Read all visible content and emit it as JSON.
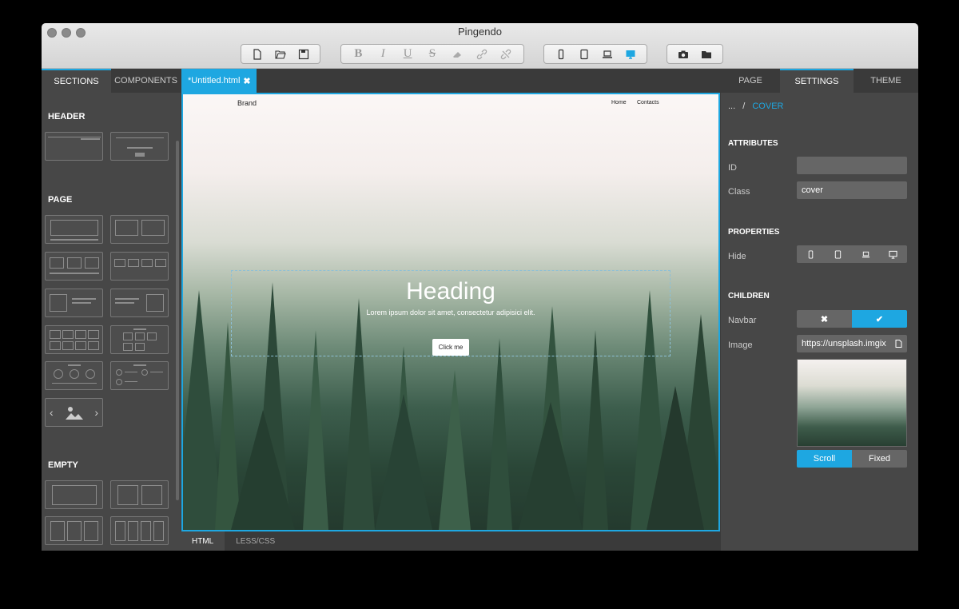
{
  "window": {
    "title": "Pingendo"
  },
  "left": {
    "tabs": [
      "SECTIONS",
      "COMPONENTS"
    ],
    "sections": [
      "HEADER",
      "PAGE",
      "EMPTY"
    ]
  },
  "editor": {
    "file_tab": "*Untitled.html",
    "code_tabs": [
      "HTML",
      "LESS/CSS"
    ]
  },
  "preview": {
    "brand": "Brand",
    "nav_links": [
      "Home",
      "Contacts"
    ],
    "heading": "Heading",
    "lead": "Lorem ipsum dolor sit amet, consectetur adipisici elit.",
    "button": "Click me"
  },
  "right": {
    "tabs": [
      "PAGE",
      "SETTINGS",
      "THEME"
    ],
    "breadcrumb": {
      "parent": "...",
      "sep": "/",
      "current": "COVER"
    },
    "attributes": {
      "title": "ATTRIBUTES",
      "id_label": "ID",
      "id_value": "",
      "class_label": "Class",
      "class_value": "cover"
    },
    "properties": {
      "title": "PROPERTIES",
      "hide_label": "Hide"
    },
    "children": {
      "title": "CHILDREN",
      "navbar_label": "Navbar",
      "image_label": "Image",
      "image_url": "https://unsplash.imgix"
    },
    "bg_modes": [
      "Scroll",
      "Fixed"
    ]
  },
  "colors": {
    "accent": "#1ea7e1",
    "panel": "#474747"
  }
}
